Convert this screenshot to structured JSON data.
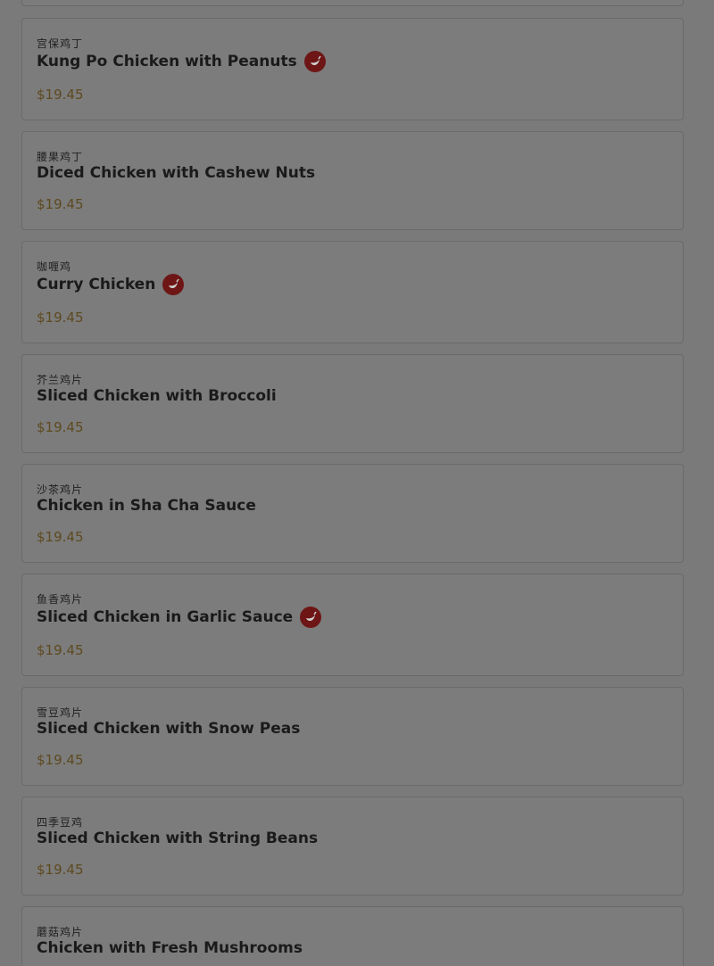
{
  "menu_items": [
    {
      "chinese": "宫保鸡丁",
      "name": "Kung Po Chicken with Peanuts",
      "spicy": true,
      "price": "$19.45"
    },
    {
      "chinese": "腰果鸡丁",
      "name": "Diced Chicken with Cashew Nuts",
      "spicy": false,
      "price": "$19.45"
    },
    {
      "chinese": "咖喱鸡",
      "name": "Curry Chicken",
      "spicy": true,
      "price": "$19.45"
    },
    {
      "chinese": "芥兰鸡片",
      "name": "Sliced Chicken with Broccoli",
      "spicy": false,
      "price": "$19.45"
    },
    {
      "chinese": "沙茶鸡片",
      "name": "Chicken in Sha Cha Sauce",
      "spicy": false,
      "price": "$19.45"
    },
    {
      "chinese": "鱼香鸡片",
      "name": "Sliced Chicken in Garlic Sauce",
      "spicy": true,
      "price": "$19.45"
    },
    {
      "chinese": "雪豆鸡片",
      "name": "Sliced Chicken with Snow Peas",
      "spicy": false,
      "price": "$19.45"
    },
    {
      "chinese": "四季豆鸡",
      "name": "Sliced Chicken with String Beans",
      "spicy": false,
      "price": "$19.45"
    },
    {
      "chinese": "蘑菇鸡片",
      "name": "Chicken with Fresh Mushrooms",
      "spicy": false,
      "price": ""
    }
  ],
  "colors": {
    "overlay": "#7a7a7a",
    "spicy_badge": "#6e1616",
    "price": "#5e4a1f"
  },
  "icons": {
    "spicy": "chili-pepper-icon"
  }
}
